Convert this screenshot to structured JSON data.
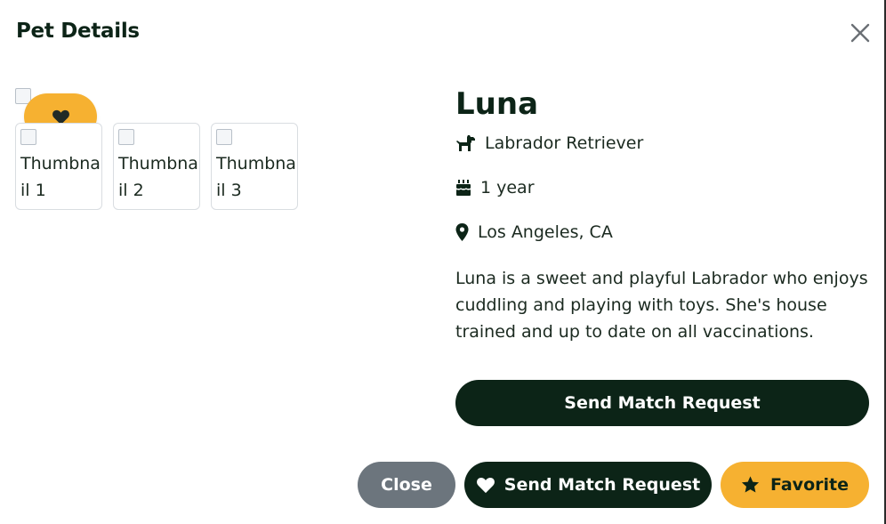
{
  "modal": {
    "title": "Pet Details"
  },
  "gallery": {
    "thumbnails": [
      {
        "alt": "Thumbnail 1"
      },
      {
        "alt": "Thumbnail 2"
      },
      {
        "alt": "Thumbnail 3"
      }
    ]
  },
  "pet": {
    "name": "Luna",
    "breed": "Labrador Retriever",
    "age": "1 year",
    "location": "Los Angeles, CA",
    "description": "Luna is a sweet and playful Labrador who enjoys cuddling and playing with toys. She's house trained and up to date on all vaccinations."
  },
  "actions": {
    "primary_match": "Send Match Request",
    "close": "Close",
    "match": "Send Match Request",
    "favorite": "Favorite"
  },
  "icons": {
    "close": "close-icon",
    "heart": "heart-icon",
    "dog": "dog-icon",
    "cake": "birthday-cake-icon",
    "location": "map-pin-icon",
    "star": "star-icon"
  },
  "colors": {
    "primary": "#0c2417",
    "accent": "#f6b131",
    "secondary": "#6c757d"
  }
}
